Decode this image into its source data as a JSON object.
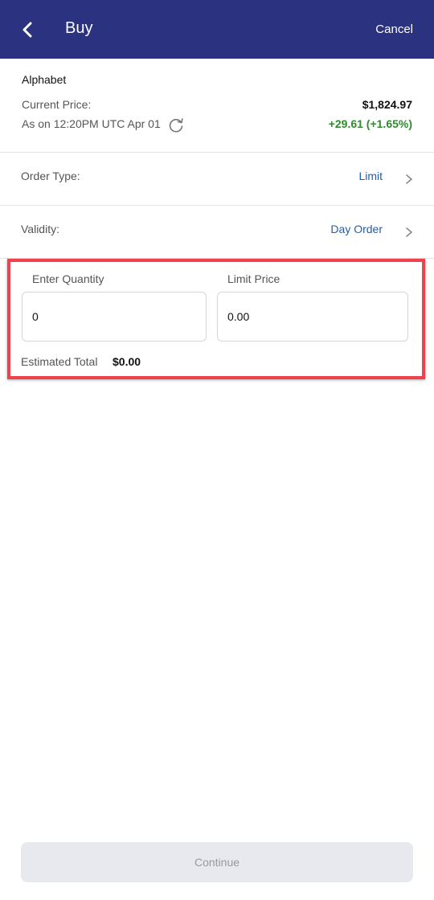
{
  "header": {
    "title": "Buy",
    "cancel_label": "Cancel",
    "back_icon": "chevron-left-icon"
  },
  "stock": {
    "name": "Alphabet",
    "price_label": "Current Price:",
    "price_value": "$1,824.97",
    "as_of": "As on 12:20PM UTC Apr 01",
    "change": "+29.61 (+1.65%)",
    "refresh_icon": "refresh-icon"
  },
  "order_type": {
    "label": "Order Type:",
    "value": "Limit"
  },
  "validity": {
    "label": "Validity:",
    "value": "Day Order"
  },
  "order_entry": {
    "quantity_label": "Enter Quantity",
    "quantity_value": "0",
    "limit_price_label": "Limit Price",
    "limit_price_value": "0.00",
    "estimated_total_label": "Estimated Total",
    "estimated_total_value": "$0.00"
  },
  "continue_label": "Continue",
  "colors": {
    "header_bg": "#2b3280",
    "positive": "#2e8b2e",
    "link": "#1e5fb0",
    "highlight": "#f0424a"
  }
}
